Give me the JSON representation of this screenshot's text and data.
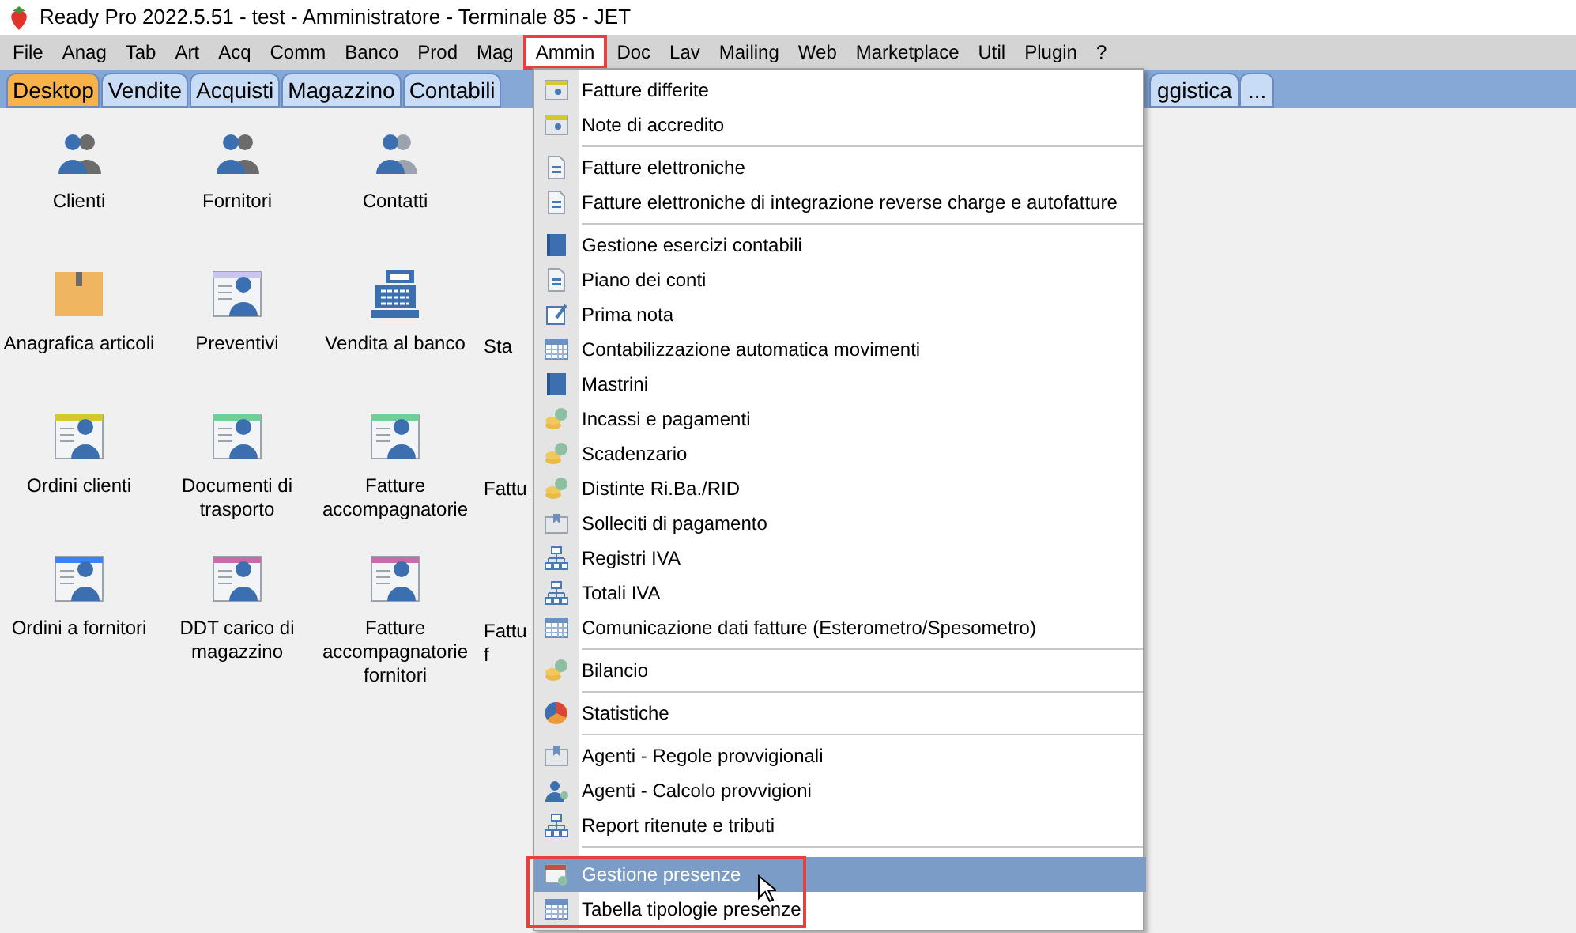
{
  "window": {
    "title": "Ready Pro 2022.5.51 - test - Amministratore - Terminale 85 - JET"
  },
  "menubar": [
    {
      "label": "File",
      "selected": false
    },
    {
      "label": "Anag",
      "selected": false
    },
    {
      "label": "Tab",
      "selected": false
    },
    {
      "label": "Art",
      "selected": false
    },
    {
      "label": "Acq",
      "selected": false
    },
    {
      "label": "Comm",
      "selected": false
    },
    {
      "label": "Banco",
      "selected": false
    },
    {
      "label": "Prod",
      "selected": false
    },
    {
      "label": "Mag",
      "selected": false
    },
    {
      "label": "Ammin",
      "selected": true
    },
    {
      "label": "Doc",
      "selected": false
    },
    {
      "label": "Lav",
      "selected": false
    },
    {
      "label": "Mailing",
      "selected": false
    },
    {
      "label": "Web",
      "selected": false
    },
    {
      "label": "Marketplace",
      "selected": false
    },
    {
      "label": "Util",
      "selected": false
    },
    {
      "label": "Plugin",
      "selected": false
    },
    {
      "label": "?",
      "selected": false
    }
  ],
  "tabs_left": [
    {
      "label": "Desktop",
      "selected": true
    },
    {
      "label": "Vendite",
      "selected": false
    },
    {
      "label": "Acquisti",
      "selected": false
    },
    {
      "label": "Magazzino",
      "selected": false
    },
    {
      "label": "Contabili",
      "selected": false
    }
  ],
  "tabs_right": [
    {
      "label": "ggistica",
      "selected": false
    },
    {
      "label": "...",
      "selected": false
    }
  ],
  "desktop": [
    {
      "label": "Clienti",
      "kind": "people"
    },
    {
      "label": "Fornitori",
      "kind": "people"
    },
    {
      "label": "Contatti",
      "kind": "person"
    },
    {
      "kind": "cut"
    },
    {
      "label": "Anagrafica articoli",
      "kind": "box"
    },
    {
      "label": "Preventivi",
      "kind": "card",
      "color": "#c9c4f0"
    },
    {
      "label": "Vendita al banco",
      "kind": "register"
    },
    {
      "label": "Sta",
      "kind": "cut"
    },
    {
      "label": "Ordini clienti",
      "kind": "card",
      "color": "#d4c92a"
    },
    {
      "label": "Documenti di trasporto",
      "kind": "card",
      "color": "#6fcf97"
    },
    {
      "label": "Fatture accompagnatorie",
      "kind": "card",
      "color": "#6fcf97"
    },
    {
      "label": "Fattu",
      "kind": "cut"
    },
    {
      "label": "Ordini a fornitori",
      "kind": "card",
      "color": "#3b82f6"
    },
    {
      "label": "DDT carico di magazzino",
      "kind": "card",
      "color": "#c86ba8"
    },
    {
      "label": "Fatture accompagnatorie fornitori",
      "kind": "card",
      "color": "#c86ba8"
    },
    {
      "label": "Fattu f",
      "kind": "cut"
    }
  ],
  "menu": {
    "groups": [
      {
        "annotated": false,
        "items": [
          {
            "label": "Fatture differite",
            "kind": "sheet",
            "selected": false
          },
          {
            "label": "Note di accredito",
            "kind": "sheet",
            "selected": false
          }
        ]
      },
      {
        "annotated": false,
        "items": [
          {
            "label": "Fatture elettroniche",
            "kind": "file",
            "selected": false
          },
          {
            "label": "Fatture elettroniche di integrazione reverse charge e autofatture",
            "kind": "file",
            "selected": false
          }
        ]
      },
      {
        "annotated": false,
        "items": [
          {
            "label": "Gestione esercizi contabili",
            "kind": "book",
            "selected": false
          },
          {
            "label": "Piano dei conti",
            "kind": "file",
            "selected": false
          },
          {
            "label": "Prima nota",
            "kind": "pencil",
            "selected": false
          },
          {
            "label": "Contabilizzazione automatica movimenti",
            "kind": "grid",
            "selected": false
          },
          {
            "label": "Mastrini",
            "kind": "book",
            "selected": false
          },
          {
            "label": "Incassi e pagamenti",
            "kind": "coins",
            "selected": false
          },
          {
            "label": "Scadenzario",
            "kind": "coins",
            "selected": false
          },
          {
            "label": "Distinte Ri.Ba./RID",
            "kind": "coins",
            "selected": false
          },
          {
            "label": "Solleciti di pagamento",
            "kind": "letter",
            "selected": false
          },
          {
            "label": "Registri IVA",
            "kind": "tree",
            "selected": false
          },
          {
            "label": "Totali IVA",
            "kind": "tree",
            "selected": false
          },
          {
            "label": "Comunicazione dati fatture (Esterometro/Spesometro)",
            "kind": "grid",
            "selected": false
          }
        ]
      },
      {
        "annotated": false,
        "items": [
          {
            "label": "Bilancio",
            "kind": "coins",
            "selected": false
          }
        ]
      },
      {
        "annotated": false,
        "items": [
          {
            "label": "Statistiche",
            "kind": "pie",
            "selected": false
          }
        ]
      },
      {
        "annotated": false,
        "items": [
          {
            "label": "Agenti - Regole provvigionali",
            "kind": "letter",
            "selected": false
          },
          {
            "label": "Agenti - Calcolo provvigioni",
            "kind": "agent",
            "selected": false
          },
          {
            "label": "Report ritenute e tributi",
            "kind": "tree",
            "selected": false
          }
        ]
      },
      {
        "annotated": true,
        "items": [
          {
            "label": "Gestione presenze",
            "kind": "calendar",
            "selected": true
          },
          {
            "label": "Tabella tipologie presenze",
            "kind": "grid",
            "selected": false
          }
        ]
      }
    ]
  }
}
